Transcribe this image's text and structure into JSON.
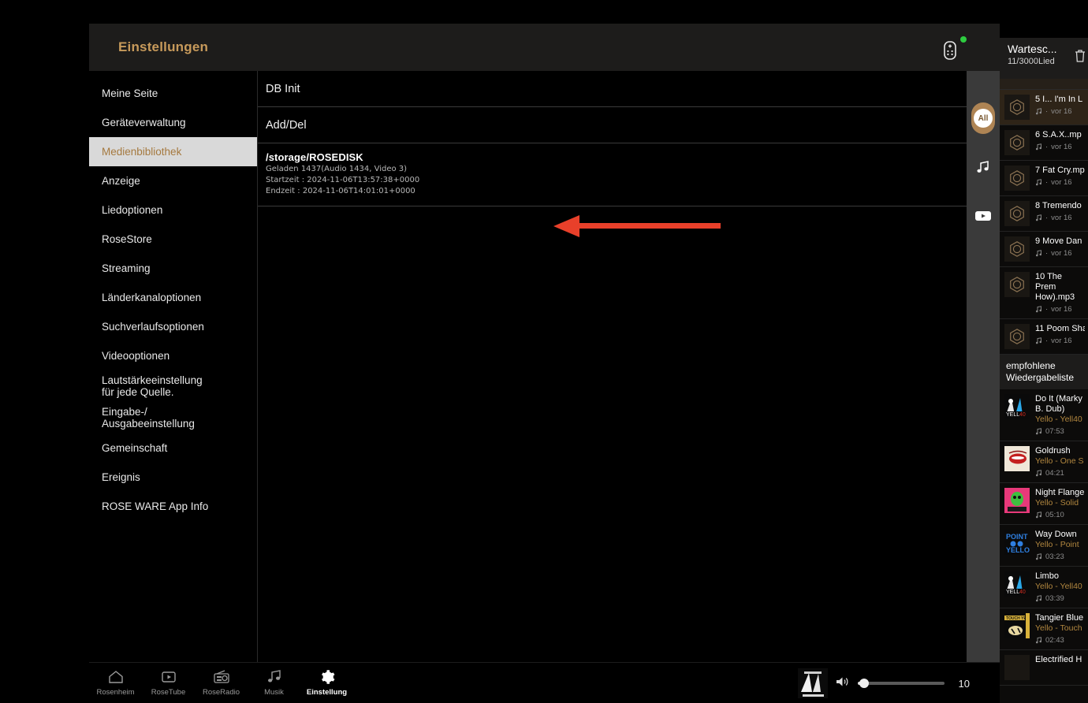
{
  "window": {
    "title": "Einstellungen",
    "remote_icon": "remote-control-icon",
    "status_dot_color": "#2ecc40"
  },
  "sidebar": {
    "items": [
      {
        "label": "Meine Seite",
        "selected": false
      },
      {
        "label": "Geräteverwaltung",
        "selected": false
      },
      {
        "label": "Medienbibliothek",
        "selected": true
      },
      {
        "label": "Anzeige",
        "selected": false
      },
      {
        "label": "Liedoptionen",
        "selected": false
      },
      {
        "label": "RoseStore",
        "selected": false
      },
      {
        "label": "Streaming",
        "selected": false
      },
      {
        "label": "Länderkanaloptionen",
        "selected": false
      },
      {
        "label": "Suchverlaufsoptionen",
        "selected": false
      },
      {
        "label": "Videooptionen",
        "selected": false
      },
      {
        "label": "Lautstärkeeinstellung",
        "label2": "für jede Quelle.",
        "selected": false
      },
      {
        "label": "Eingabe-/",
        "label2": "Ausgabeeinstellung",
        "selected": false
      },
      {
        "label": "Gemeinschaft",
        "selected": false
      },
      {
        "label": "Ereignis",
        "selected": false
      },
      {
        "label": "ROSE WARE App Info",
        "selected": false
      }
    ]
  },
  "main": {
    "sections": [
      {
        "label": "DB Init"
      },
      {
        "label": "Add/Del"
      }
    ],
    "storage": {
      "path": "/storage/ROSEDISK",
      "loaded": "Geladen 1437(Audio 1434, Video 3)",
      "start_time": "Startzeit : 2024-11-06T13:57:38+0000",
      "end_time": "Endzeit : 2024-11-06T14:01:01+0000",
      "menu_icon": "kebab-menu-icon"
    },
    "annotation": {
      "type": "arrow-left",
      "color": "#e8402a"
    }
  },
  "icon_strip": {
    "items": [
      {
        "name": "all-filter",
        "label": "All",
        "active": true
      },
      {
        "name": "music-filter",
        "label": "",
        "active": false
      },
      {
        "name": "video-filter",
        "label": "",
        "active": false
      }
    ]
  },
  "bottom_nav": {
    "tabs": [
      {
        "label": "Rosenheim",
        "icon": "home-icon",
        "active": false
      },
      {
        "label": "RoseTube",
        "icon": "play-box-icon",
        "active": false
      },
      {
        "label": "RoseRadio",
        "icon": "radio-icon",
        "active": false
      },
      {
        "label": "Musik",
        "icon": "music-note-icon",
        "active": false
      },
      {
        "label": "Einstellung",
        "icon": "gear-icon",
        "active": true
      }
    ]
  },
  "player": {
    "album_art": "album-art-thumbnail",
    "volume_icon": "speaker-icon",
    "volume_value": "10",
    "volume_percent": 5
  },
  "queue": {
    "title": "Wartesc...",
    "count": "11/3000Lied",
    "trash_icon": "trash-icon",
    "items": [
      {
        "title": "5 I... I'm In L",
        "time": "vor 16 ",
        "playing": true,
        "art": "hex"
      },
      {
        "title": "6 S.A.X..mp",
        "time": "vor 16 ",
        "playing": false,
        "art": "hex"
      },
      {
        "title": "7 Fat Cry.mp",
        "time": "vor 16 ",
        "playing": false,
        "art": "hex"
      },
      {
        "title": "8 Tremendo",
        "time": "vor 16 ",
        "playing": false,
        "art": "hex"
      },
      {
        "title": "9 Move Dan",
        "time": "vor 16 ",
        "playing": false,
        "art": "hex"
      },
      {
        "title": "10 The Prem How).mp3",
        "time": "vor 16 ",
        "playing": false,
        "art": "hex",
        "wrap": true
      },
      {
        "title": "11 Poom Sha",
        "time": "vor 16 ",
        "playing": false,
        "art": "hex"
      }
    ],
    "section_label": "empfohlene Wiedergabeliste",
    "recommended": [
      {
        "title": "Do It (Marky B. Dub)",
        "artist": "Yello - Yell40",
        "duration": "07:53",
        "art": "yell40",
        "wrap": true
      },
      {
        "title": "Goldrush",
        "artist": "Yello - One S",
        "duration": "04:21",
        "art": "lips"
      },
      {
        "title": "Night Flange",
        "artist": "Yello - Solid",
        "duration": "05:10",
        "art": "green"
      },
      {
        "title": "Way Down",
        "artist": "Yello - Point",
        "duration": "03:23",
        "art": "point"
      },
      {
        "title": "Limbo",
        "artist": "Yello - Yell40",
        "duration": "03:39",
        "art": "yell40"
      },
      {
        "title": "Tangier Blue",
        "artist": "Yello - Touch",
        "duration": "02:43",
        "art": "touch"
      }
    ],
    "partial_bottom": "Electrified H"
  },
  "colors": {
    "accent": "#c79a5b",
    "selected_nav_bg": "#d9d9d9",
    "selected_nav_text": "#a5793f",
    "artist_text": "#b2873f",
    "arrow": "#e8402a"
  }
}
